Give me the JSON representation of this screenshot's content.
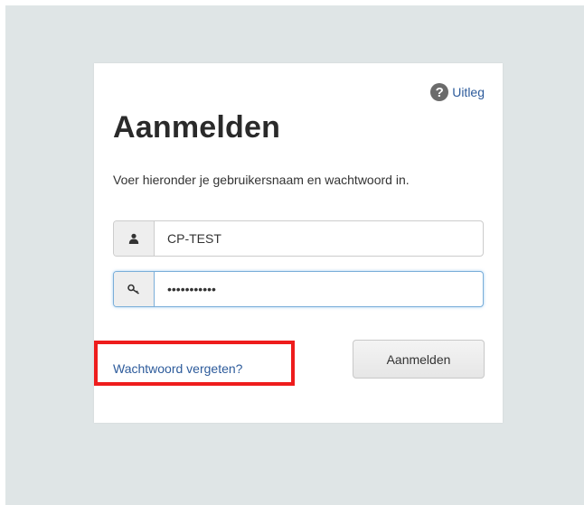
{
  "help": {
    "label": "Uitleg",
    "icon": "question-circle-icon"
  },
  "form": {
    "title": "Aanmelden",
    "instructions": "Voer hieronder je gebruikersnaam en wachtwoord in.",
    "username": {
      "value": "CP-TEST",
      "icon": "user-icon"
    },
    "password": {
      "value": "•••••••••••",
      "icon": "key-icon"
    },
    "forgot_label": "Wachtwoord vergeten?",
    "submit_label": "Aanmelden"
  },
  "colors": {
    "backdrop": "#dfe5e6",
    "link": "#2d5b9b",
    "highlight": "#ee1c1c"
  }
}
